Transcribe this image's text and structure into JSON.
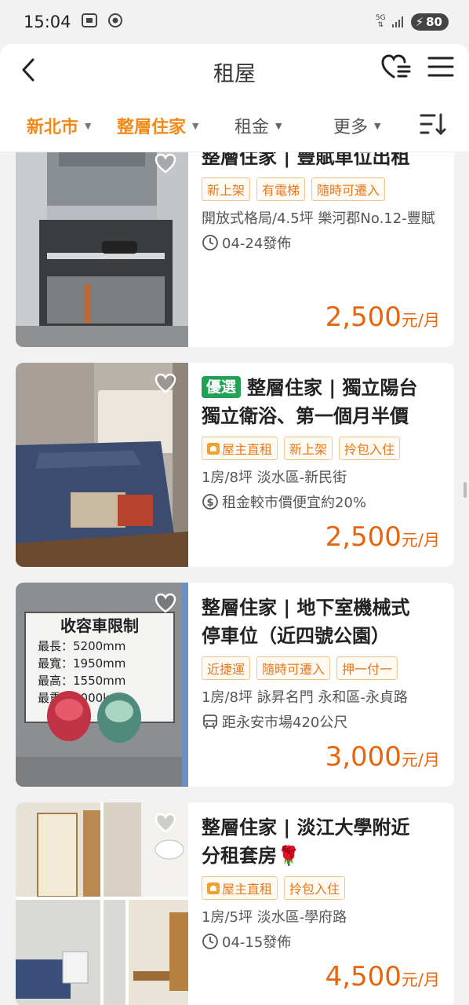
{
  "status_bar": {
    "time": "15:04",
    "network": "5G",
    "battery": "80"
  },
  "header": {
    "title": "租屋",
    "back_icon": "chevron-left-icon",
    "favorite_icon": "heart-list-icon",
    "menu_icon": "hamburger-menu-icon"
  },
  "filters": [
    {
      "label": "新北市",
      "active": true
    },
    {
      "label": "整層住家",
      "active": true
    },
    {
      "label": "租金",
      "active": false
    },
    {
      "label": "更多",
      "active": false
    }
  ],
  "colors": {
    "accent": "#f28a1a",
    "price": "#e8650c",
    "tag_border": "#f4c58a",
    "tag_text": "#e8781a",
    "badge_green": "#22a155"
  },
  "listings": [
    {
      "badge": "",
      "title_line1": "整層住家 | 豐賦車位出租",
      "title_line2": "",
      "tags": [
        {
          "label": "新上架",
          "owner": false
        },
        {
          "label": "有電梯",
          "owner": false
        },
        {
          "label": "隨時可遷入",
          "owner": false
        }
      ],
      "desc": "開放式格局/4.5坪 樂河郡No.12-豐賦",
      "meta_icon": "clock-icon",
      "meta": "04-24發佈",
      "price": "2,500",
      "unit": "元/月"
    },
    {
      "badge": "優選",
      "title_line1": "整層住家 | 獨立陽台",
      "title_line2": "獨立衛浴、第一個月半價",
      "tags": [
        {
          "label": "屋主直租",
          "owner": true
        },
        {
          "label": "新上架",
          "owner": false
        },
        {
          "label": "拎包入住",
          "owner": false
        }
      ],
      "desc": "1房/8坪 淡水區-新民街",
      "meta_icon": "dollar-circle-icon",
      "meta": "租金較市價便宜約20%",
      "price": "2,500",
      "unit": "元/月"
    },
    {
      "badge": "",
      "title_line1": "整層住家 | 地下室機械式",
      "title_line2": "停車位（近四號公園）",
      "tags": [
        {
          "label": "近捷運",
          "owner": false
        },
        {
          "label": "隨時可遷入",
          "owner": false
        },
        {
          "label": "押一付一",
          "owner": false
        }
      ],
      "desc": "1房/8坪 詠昇名門 永和區-永貞路",
      "meta_icon": "bus-icon",
      "meta": "距永安市場420公尺",
      "price": "3,000",
      "unit": "元/月",
      "sign": {
        "title": "收容車限制",
        "rows": [
          "最長：5200mm",
          "最寬：1950mm",
          "最高：1550mm",
          "最重：2000kg"
        ]
      }
    },
    {
      "badge": "",
      "title_line1": "整層住家 | 淡江大學附近",
      "title_line2": "分租套房🌹",
      "tags": [
        {
          "label": "屋主直租",
          "owner": true
        },
        {
          "label": "拎包入住",
          "owner": false
        }
      ],
      "desc": "1房/5坪 淡水區-學府路",
      "meta_icon": "clock-icon",
      "meta": "04-15發佈",
      "price": "4,500",
      "unit": "元/月"
    }
  ]
}
